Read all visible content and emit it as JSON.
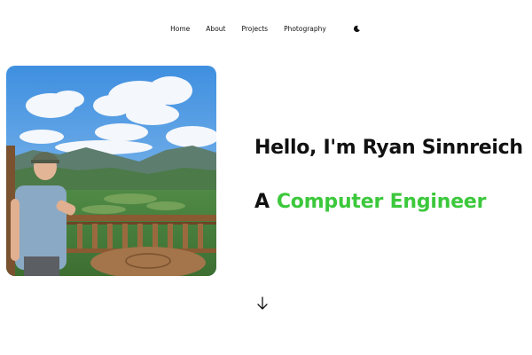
{
  "nav": {
    "items": [
      {
        "label": "Home"
      },
      {
        "label": "About"
      },
      {
        "label": "Projects"
      },
      {
        "label": "Photography"
      }
    ],
    "theme_toggle_icon": "moon-icon"
  },
  "hero": {
    "greeting": "Hello, I'm Ryan Sinnreich",
    "role_prefix": "A",
    "role_text": "Computer Engineer",
    "role_color": "#3cc83c",
    "scroll_icon": "arrow-down-icon"
  },
  "colors": {
    "background": "#ffffff",
    "text": "#111111",
    "accent": "#3cc83c"
  }
}
